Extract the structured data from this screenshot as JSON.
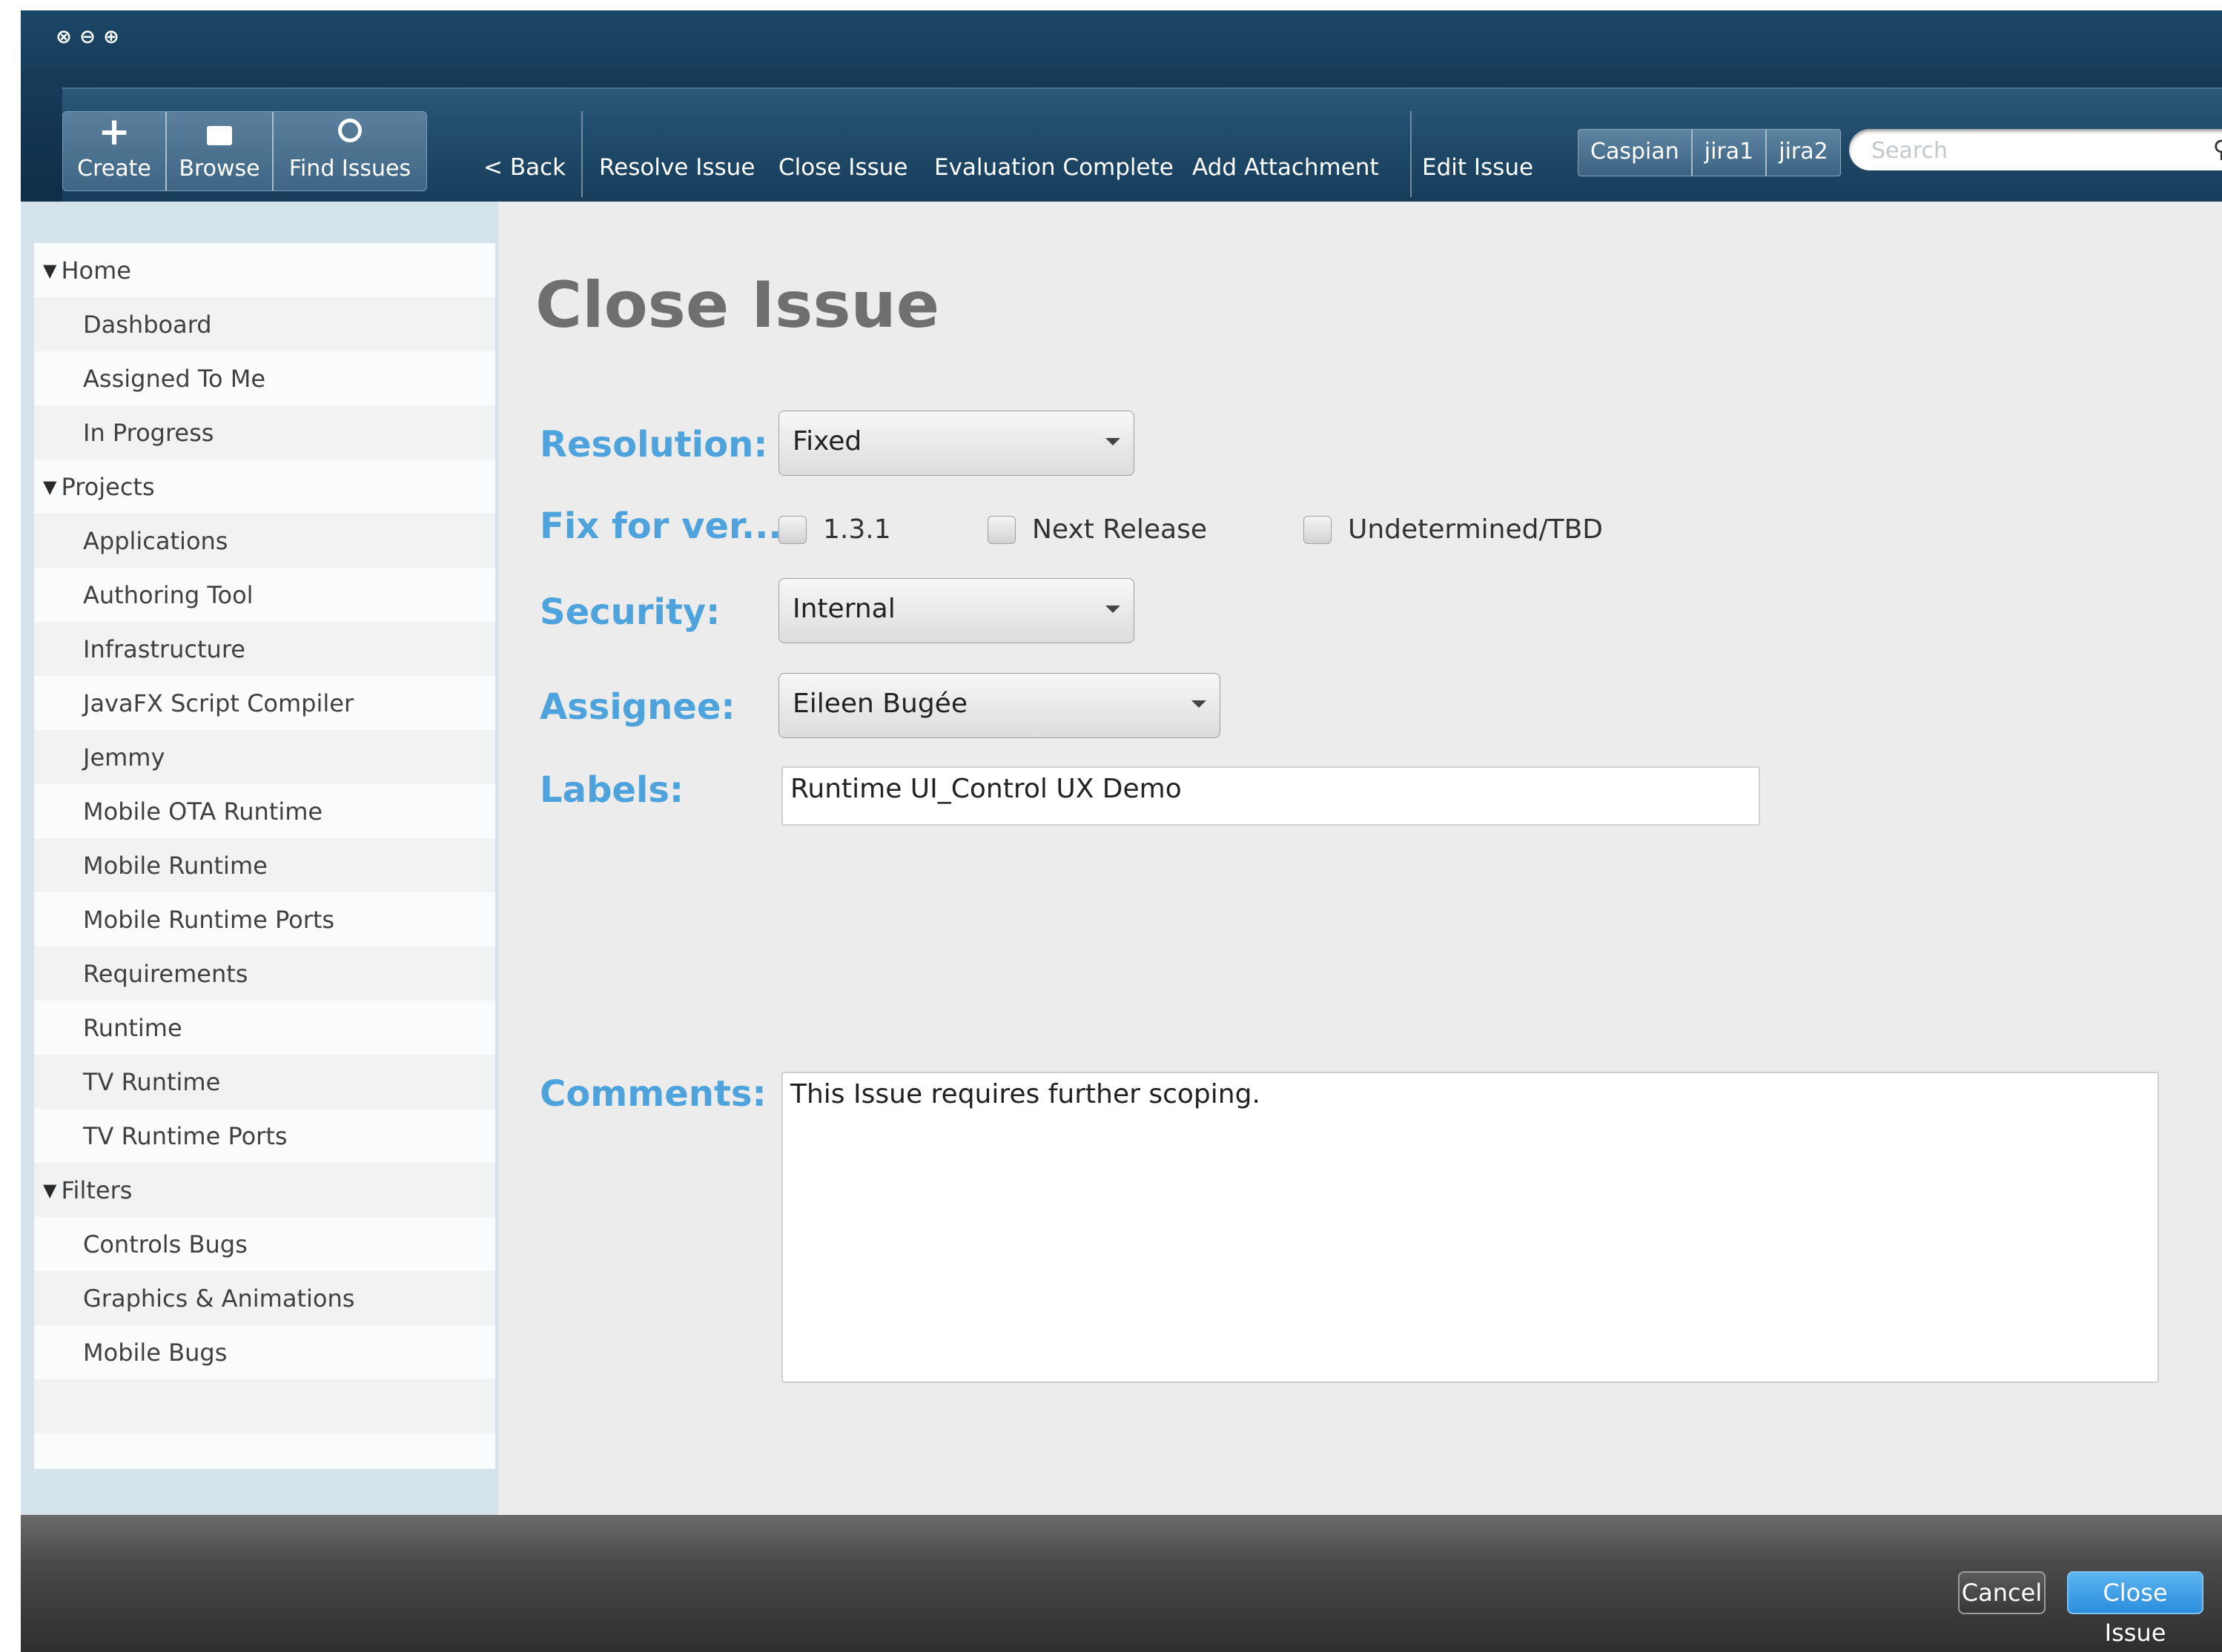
{
  "window_controls": [
    "⊗",
    "⊖",
    "⊕"
  ],
  "toolbar": {
    "buttons": [
      {
        "label": "Create",
        "icon": "plus-icon",
        "glyph": "+"
      },
      {
        "label": "Browse",
        "icon": "folder-icon",
        "glyph": "▬"
      },
      {
        "label": "Find Issues",
        "icon": "search-icon",
        "glyph": "🔍"
      }
    ],
    "back_label": "< Back",
    "actions": [
      "Resolve Issue",
      "Close Issue",
      "Evaluation Complete",
      "Add Attachment",
      "Edit Issue"
    ],
    "users": [
      "Caspian",
      "jira1",
      "jira2"
    ],
    "search_placeholder": "Search"
  },
  "sidebar": {
    "sections": [
      {
        "label": "Home",
        "items": [
          "Dashboard",
          "Assigned To Me",
          "In Progress"
        ]
      },
      {
        "label": "Projects",
        "items": [
          "Applications",
          "Authoring Tool",
          "Infrastructure",
          "JavaFX Script Compiler",
          "Jemmy",
          "Mobile OTA Runtime",
          "Mobile Runtime",
          "Mobile Runtime Ports",
          "Requirements",
          "Runtime",
          "TV Runtime",
          "TV Runtime Ports"
        ]
      },
      {
        "label": "Filters",
        "items": [
          "Controls Bugs",
          "Graphics & Animations",
          "Mobile Bugs"
        ]
      }
    ]
  },
  "form": {
    "title": "Close Issue",
    "resolution": {
      "label": "Resolution:",
      "value": "Fixed"
    },
    "fix_for": {
      "label": "Fix for ver...",
      "options": [
        {
          "label": "1.3.1",
          "checked": false
        },
        {
          "label": "Next Release",
          "checked": false
        },
        {
          "label": "Undetermined/TBD",
          "checked": false
        }
      ]
    },
    "security": {
      "label": "Security:",
      "value": "Internal"
    },
    "assignee": {
      "label": "Assignee:",
      "value": "Eileen Bugée"
    },
    "labels": {
      "label": "Labels:",
      "value": "Runtime UI_Control UX Demo"
    },
    "comments": {
      "label": "Comments:",
      "value": "This Issue requires further scoping."
    }
  },
  "footer": {
    "cancel_label": "Cancel",
    "submit_label": "Close Issue"
  },
  "colors": {
    "accent": "#4ea3dd",
    "header": "#163a58",
    "primary_button": "#3a9ee6"
  }
}
